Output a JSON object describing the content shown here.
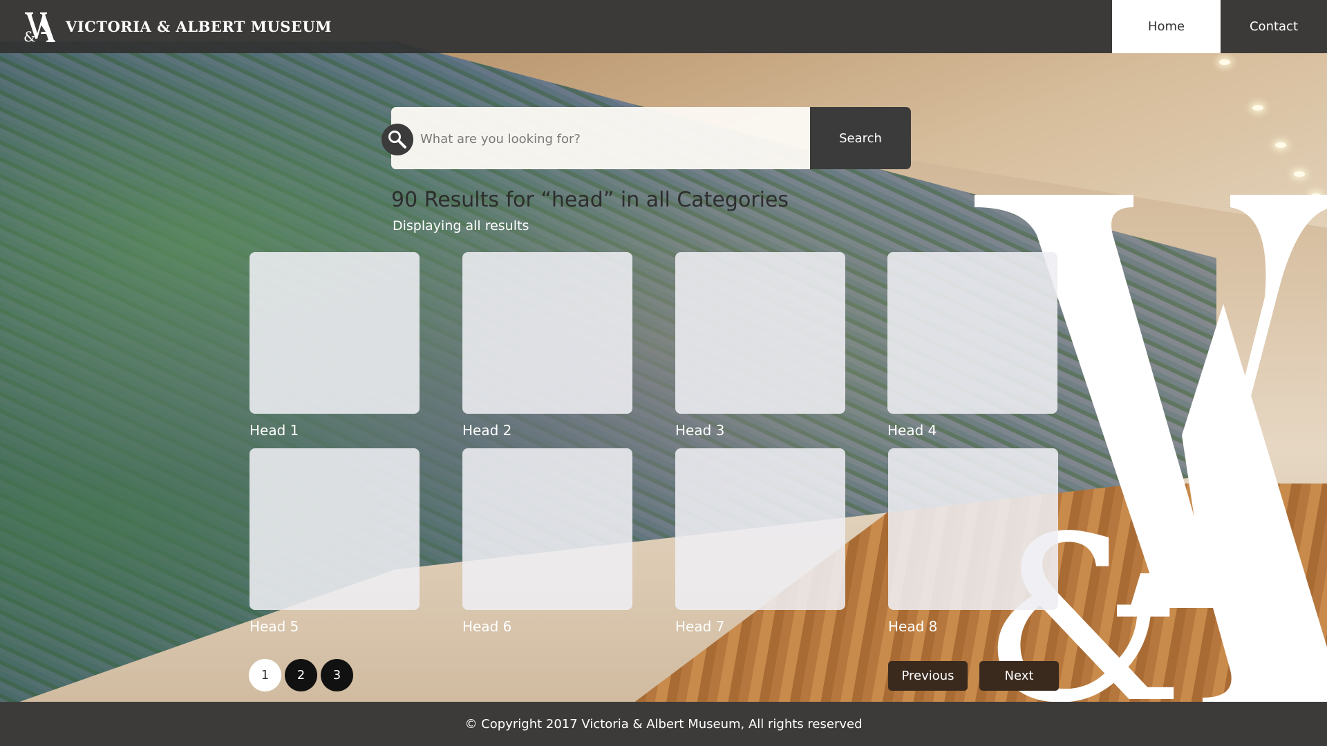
{
  "header": {
    "site_title": "VICTORIA & ALBERT MUSEUM",
    "logo_icon": "va-monogram-icon",
    "nav": [
      {
        "label": "Home",
        "active": true
      },
      {
        "label": "Contact",
        "active": false
      }
    ]
  },
  "search": {
    "icon": "search-icon",
    "placeholder": "What are you looking for?",
    "value": "",
    "button_label": "Search"
  },
  "results": {
    "title": "90 Results for “head” in all Categories",
    "subtitle": "Displaying all results"
  },
  "cards": [
    {
      "label": "Head 1"
    },
    {
      "label": "Head 2"
    },
    {
      "label": "Head 3"
    },
    {
      "label": "Head 4"
    },
    {
      "label": "Head 5"
    },
    {
      "label": "Head 6"
    },
    {
      "label": "Head 7"
    },
    {
      "label": "Head 8"
    }
  ],
  "pagination": {
    "pages": [
      "1",
      "2",
      "3"
    ],
    "current": "1",
    "previous_label": "Previous",
    "next_label": "Next"
  },
  "footer": {
    "copyright": "© Copyright 2017 Victoria & Albert Museum, All rights reserved"
  },
  "colors": {
    "header_bg": "#323232",
    "search_button_bg": "#3b3b3b",
    "pager_button_bg": "#3a2a1e",
    "footer_bg": "#3c3b3a"
  }
}
